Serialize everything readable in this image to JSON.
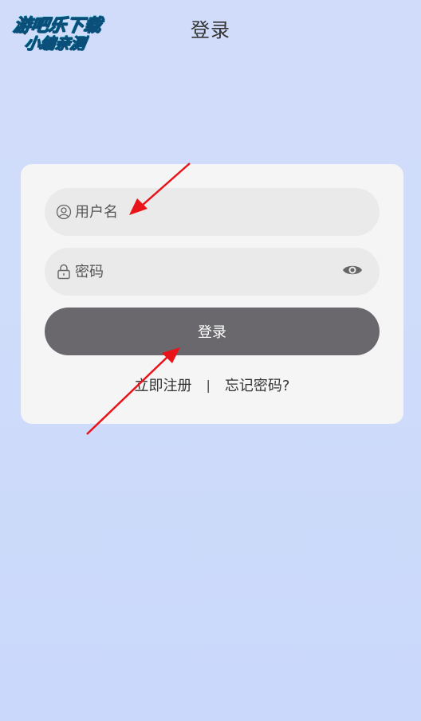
{
  "header": {
    "title": "登录",
    "back_icon": "chevron-left-icon"
  },
  "watermark": {
    "line1": "游吧乐下载",
    "line2": "小编亲测"
  },
  "form": {
    "username_placeholder": "用户名",
    "username_icon": "user-icon",
    "password_placeholder": "密码",
    "password_icon": "lock-icon",
    "toggle_icon": "eye-icon",
    "login_label": "登录"
  },
  "links": {
    "register": "立即注册",
    "separator": "|",
    "forgot": "忘记密码?"
  },
  "colors": {
    "background": "#cfdcfa",
    "card": "#f5f5f5",
    "field": "#eaeaea",
    "button": "#6a686d",
    "annotation_arrow": "#e8141a"
  }
}
